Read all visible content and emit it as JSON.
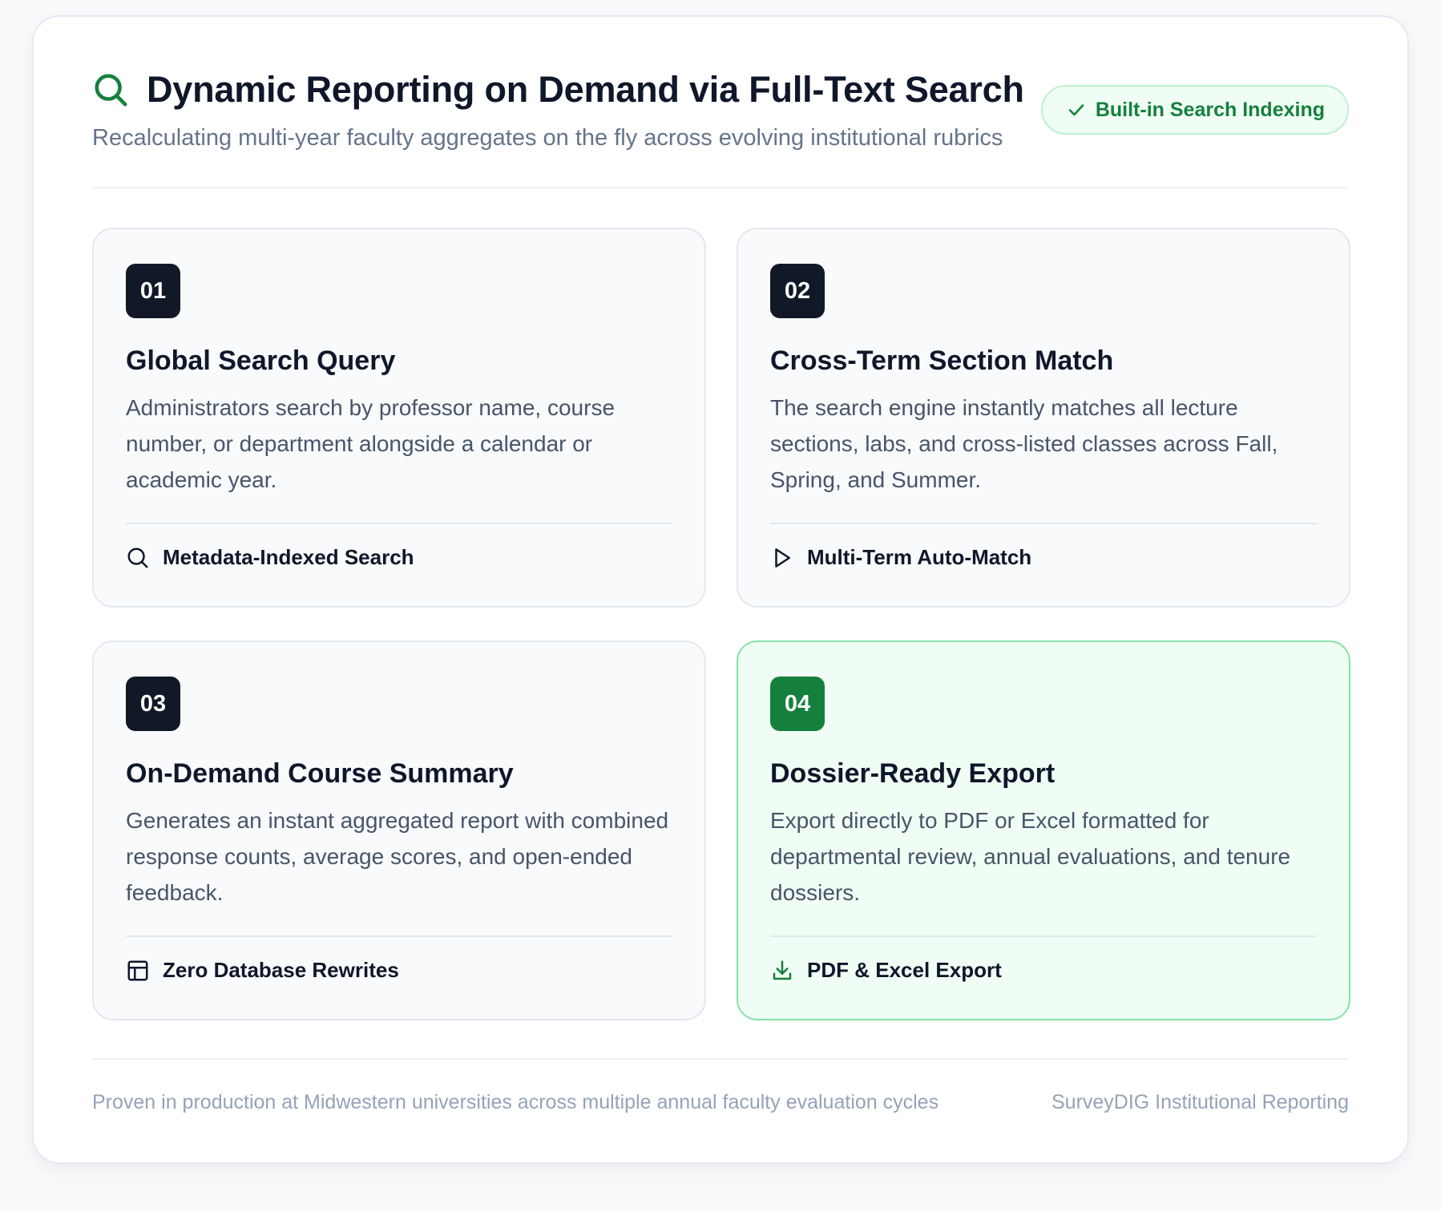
{
  "header": {
    "title": "Dynamic Reporting on Demand via Full-Text Search",
    "subtitle": "Recalculating multi-year faculty aggregates on the fly across evolving institutional rubrics",
    "icon": "search-icon",
    "badge_label": "Built-in Search Indexing",
    "badge_icon": "check-icon"
  },
  "steps": [
    {
      "number": "01",
      "title": "Global Search Query",
      "description": "Administrators search by professor name, course number, or department alongside a calendar or academic year.",
      "feature_label": "Metadata-Indexed Search",
      "feature_icon": "search-icon"
    },
    {
      "number": "02",
      "title": "Cross-Term Section Match",
      "description": "The search engine instantly matches all lecture sections, labs, and cross-listed classes across Fall, Spring, and Summer.",
      "feature_label": "Multi-Term Auto-Match",
      "feature_icon": "play-icon"
    },
    {
      "number": "03",
      "title": "On-Demand Course Summary",
      "description": "Generates an instant aggregated report with combined response counts, average scores, and open-ended feedback.",
      "feature_label": "Zero Database Rewrites",
      "feature_icon": "layout-icon"
    },
    {
      "number": "04",
      "title": "Dossier-Ready Export",
      "description": "Export directly to PDF or Excel formatted for departmental review, annual evaluations, and tenure dossiers.",
      "feature_label": "PDF & Excel Export",
      "feature_icon": "download-icon"
    }
  ],
  "footer": {
    "left": "Proven in production at Midwestern universities across multiple annual faculty evaluation cycles",
    "right": "SurveyDIG Institutional Reporting"
  },
  "colors": {
    "accent_green": "#15803d",
    "dark": "#111827",
    "muted": "#64748b"
  }
}
